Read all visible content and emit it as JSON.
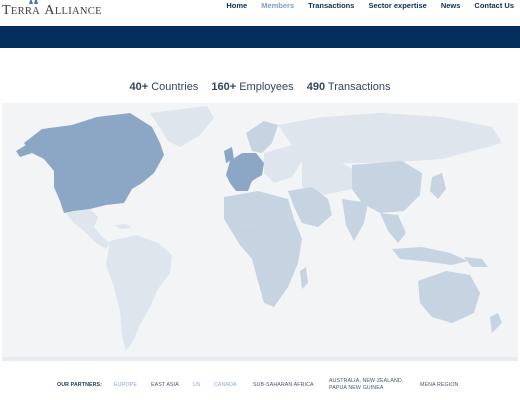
{
  "brand": {
    "name_line": "TERRA ALLIANCE",
    "cap1": "T",
    "rest1": "ERRA",
    "cap2": "A",
    "rest2": "LLIANCE"
  },
  "nav": {
    "items": [
      {
        "label": "Home",
        "active": false
      },
      {
        "label": "Members",
        "active": true
      },
      {
        "label": "Transactions",
        "active": false
      },
      {
        "label": "Sector expertise",
        "active": false
      },
      {
        "label": "News",
        "active": false
      },
      {
        "label": "Contact Us",
        "active": false
      }
    ]
  },
  "stats": [
    {
      "value": "40+",
      "label": "Countries"
    },
    {
      "value": "160+",
      "label": "Employees"
    },
    {
      "value": "490",
      "label": "Transactions"
    }
  ],
  "map": {
    "highlighted_regions": [
      "North America",
      "Western Europe"
    ],
    "colors": {
      "background": "#f2f4f6",
      "land": "#dfe5ec",
      "member": "#c6d3e1",
      "highlight": "#8ca6c5"
    }
  },
  "partners": {
    "label": "OUR PARTNERS:",
    "items": [
      {
        "label": "EUROPE",
        "style": "link"
      },
      {
        "label": "EAST ASIA",
        "style": "plain"
      },
      {
        "label": "US",
        "style": "link"
      },
      {
        "label": "CANADA",
        "style": "link"
      },
      {
        "label": "SUB-SAHARAN AFRICA",
        "style": "plain"
      },
      {
        "label": "AUSTRALIA, NEW ZEALAND,",
        "label2": "PAPUA NEW GUINEA",
        "style": "plain"
      },
      {
        "label": "MENA REGION",
        "style": "plain"
      }
    ]
  },
  "colors": {
    "navy": "#032e5e",
    "nav_text": "#0d2d57",
    "nav_active": "#7c9ccf"
  }
}
